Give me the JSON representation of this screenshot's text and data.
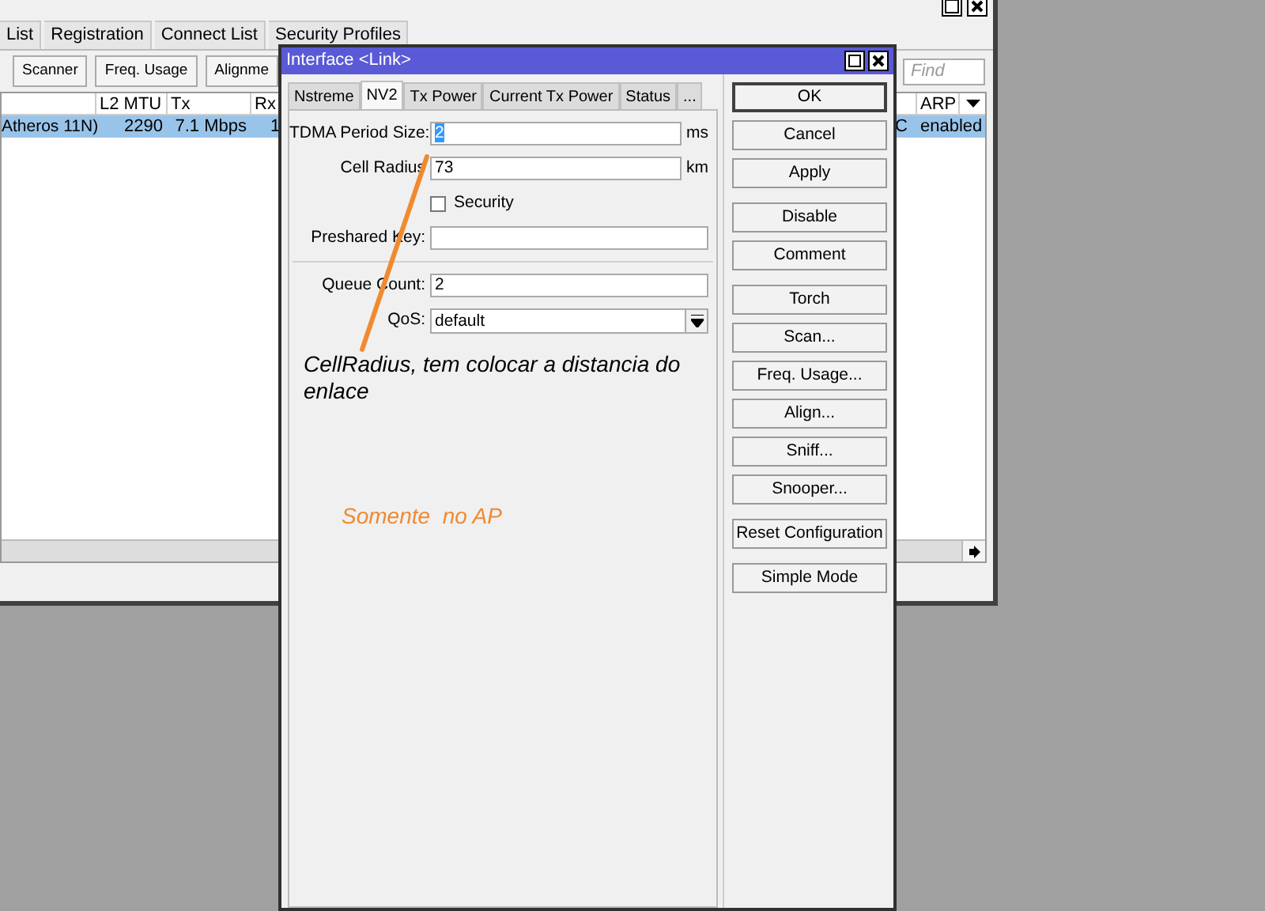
{
  "back_window": {
    "tabs": [
      {
        "label": "List",
        "selected": false
      },
      {
        "label": "Registration",
        "selected": false
      },
      {
        "label": "Connect List",
        "selected": false
      },
      {
        "label": "Security Profiles",
        "selected": false
      }
    ],
    "toolbar": [
      "Scanner",
      "Freq. Usage",
      "Alignme"
    ],
    "find": {
      "placeholder": "Find"
    },
    "table": {
      "columns": [
        "L2 MTU",
        "Tx",
        "Rx",
        "ARP"
      ],
      "rows": [
        {
          "selected": true,
          "column_1": "Atheros 11N)",
          "l2_mtu": "2290",
          "tx": "7.1 Mbps",
          "rx": "1",
          "column_5": "C",
          "arp": "enabled"
        }
      ]
    }
  },
  "dialog": {
    "title": "Interface <Link>",
    "tabs": [
      {
        "label": "Nstreme",
        "selected": false
      },
      {
        "label": "NV2",
        "selected": true
      },
      {
        "label": "Tx Power",
        "selected": false
      },
      {
        "label": "Current Tx Power",
        "selected": false
      },
      {
        "label": "Status",
        "selected": false
      },
      {
        "label": "...",
        "selected": false
      }
    ],
    "fields": [
      {
        "kind": "text",
        "label": "TDMA Period Size:",
        "value": "2",
        "unit": "ms",
        "highlighted": true
      },
      {
        "kind": "text",
        "label": "Cell Radius",
        "value": "73",
        "unit": "km",
        "highlighted": false
      },
      {
        "kind": "checkbox",
        "label": "Security",
        "checked": false
      },
      {
        "kind": "text",
        "label": "Preshared Key:"
      },
      {
        "kind": "separator"
      },
      {
        "kind": "text",
        "label": "Queue Count:",
        "value": "2",
        "highlighted": false
      },
      {
        "kind": "select",
        "label": "QoS:",
        "value": "default"
      }
    ],
    "button_groups": [
      [
        {
          "label": "OK",
          "default": true
        },
        {
          "label": "Cancel",
          "default": false
        },
        {
          "label": "Apply",
          "default": false
        }
      ],
      [
        {
          "label": "Disable",
          "default": false
        },
        {
          "label": "Comment",
          "default": false
        }
      ],
      [
        {
          "label": "Torch",
          "default": false
        },
        {
          "label": "Scan...",
          "default": false
        },
        {
          "label": "Freq. Usage...",
          "default": false
        },
        {
          "label": "Align...",
          "default": false
        },
        {
          "label": "Sniff...",
          "default": false
        },
        {
          "label": "Snooper...",
          "default": false
        }
      ],
      [
        {
          "label": "Reset Configuration",
          "default": false
        }
      ],
      [
        {
          "label": "Simple Mode",
          "default": false
        }
      ]
    ]
  },
  "annotations": [
    {
      "kind": "note",
      "text": "CellRadius, tem colocar a distancia do enlace",
      "color": "#000000"
    },
    {
      "kind": "note",
      "text": "Somente  no AP",
      "color": "#f08a30"
    }
  ]
}
